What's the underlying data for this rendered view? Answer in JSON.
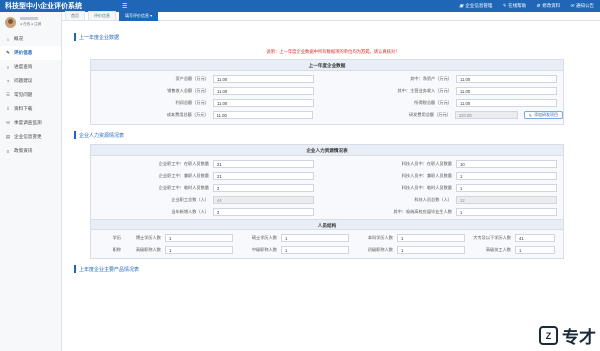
{
  "app": {
    "title": "科技型中小企业评价系统",
    "menu_icon": "☰",
    "header_links": [
      {
        "icon": "building-icon",
        "glyph": "▣",
        "label": "企业信息管理"
      },
      {
        "icon": "pencil-icon",
        "glyph": "✎",
        "label": "在线帮助"
      },
      {
        "icon": "gear-icon",
        "glyph": "⚙",
        "label": "修改资料"
      },
      {
        "icon": "bell-icon",
        "glyph": "✉",
        "label": "通知公告"
      }
    ]
  },
  "user": {
    "status": "● 在线  ● 注销"
  },
  "sidebar": {
    "items": [
      {
        "icon": "⌂",
        "label": "概况"
      },
      {
        "icon": "✎",
        "label": "评价信息"
      },
      {
        "icon": "⌕",
        "label": "进度查询"
      },
      {
        "icon": "?",
        "label": "问题建议"
      },
      {
        "icon": "☰",
        "label": "常见问题"
      },
      {
        "icon": "⇩",
        "label": "资料下载"
      },
      {
        "icon": "✉",
        "label": "季度调查监测"
      },
      {
        "icon": "▤",
        "label": "企业信息变更"
      },
      {
        "icon": "≡",
        "label": "政策资讯"
      }
    ]
  },
  "tabs": [
    "首页",
    "评价信息",
    "填写评价信息 ▾"
  ],
  "section1": {
    "title": "上一年度企业数据",
    "notice_pre": "说明：上一年度企业数据中所有数据项的单位均为",
    "notice_bold": "万元",
    "notice_post": "，请认真核对！",
    "panel_title": "上一年度企业数据",
    "rows": [
      {
        "l_label": "资产总额（万元）",
        "l_value": "11.00",
        "r_label": "其中：净资产（万元）",
        "r_value": "11.00"
      },
      {
        "l_label": "销售收入总额（万元）",
        "l_value": "11.00",
        "r_label": "其中：主营业务收入（万元）",
        "r_value": "11.00"
      },
      {
        "l_label": "利润总额（万元）",
        "l_value": "11.00",
        "r_label": "所得税总额（万元）",
        "r_value": "11.00"
      },
      {
        "l_label": "成本费用总额（万元）",
        "l_value": "11.00",
        "r_label": "研发费用总额（万元）",
        "r_value": "220.00"
      }
    ],
    "fill_button": "添加研发项目"
  },
  "section2": {
    "title": "企业人力资源情况表",
    "panel_title": "企业人力资源情况表",
    "rows": [
      {
        "l_label": "企业职工中：在职人员数量",
        "l_value": "21",
        "r_label": "科技人员中：在职人员数量",
        "r_value": "10"
      },
      {
        "l_label": "企业职工中：兼职人员数量",
        "l_value": "21",
        "r_label": "科技人员中：兼职人员数量",
        "r_value": "1"
      },
      {
        "l_label": "企业职工中：临时人员数量",
        "l_value": "2",
        "r_label": "科技人员中：临时人员数量",
        "r_value": "1"
      },
      {
        "l_label": "企业职工总数（人）",
        "l_value": "44",
        "r_label": "科技人员总数（人）",
        "r_value": "12"
      },
      {
        "l_label": "当年新增人数（人）",
        "l_value": "2",
        "r_label": "其中：吸纳高校应届毕业生人数",
        "r_value": "1"
      }
    ],
    "structure_title": "人员结构",
    "edu_label": "学历",
    "edu": [
      {
        "label": "博士学历人数",
        "value": "1"
      },
      {
        "label": "硕士学历人数",
        "value": "1"
      },
      {
        "label": "本科学历人数",
        "value": "1"
      },
      {
        "label": "大专及以下学历人数",
        "value": "41"
      }
    ],
    "title_label": "职称",
    "titles": [
      {
        "label": "高级职称人数",
        "value": "1"
      },
      {
        "label": "中级职称人数",
        "value": "1"
      },
      {
        "label": "初级职称人数",
        "value": "1"
      },
      {
        "label": "高级技工人数",
        "value": "1"
      }
    ]
  },
  "section3": {
    "title": "上年度企业主要产品情况表"
  },
  "watermark": {
    "logo": "Z",
    "text": "专才"
  }
}
